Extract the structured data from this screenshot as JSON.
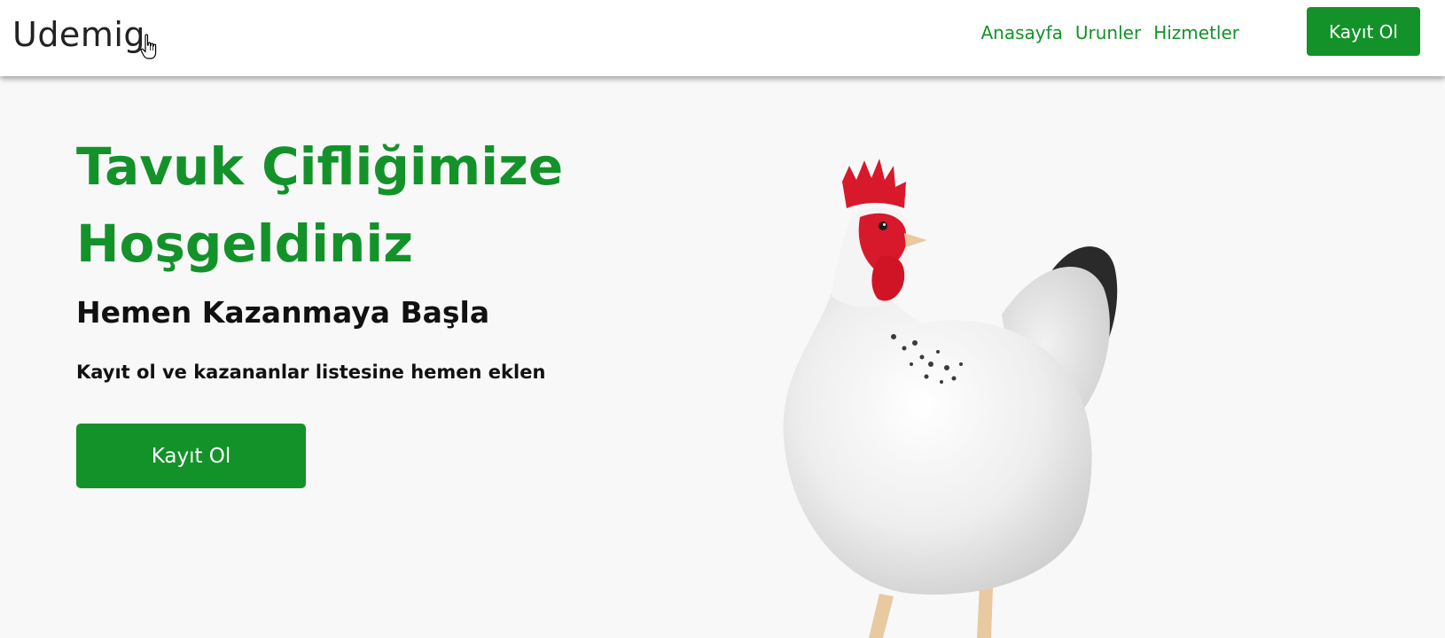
{
  "navbar": {
    "brand": "Udemig",
    "links": [
      "Anasayfa",
      "Urunler",
      "Hizmetler"
    ],
    "signup_label": "Kayıt Ol"
  },
  "hero": {
    "title": "Tavuk Çifliğimize Hoşgeldiniz",
    "subtitle": "Hemen Kazanmaya Başla",
    "text": "Kayıt ol ve kazananlar listesine hemen eklen",
    "button_label": "Kayıt Ol"
  },
  "colors": {
    "accent": "#14922a",
    "background": "#f8f8f9",
    "navbar": "#ffffff"
  },
  "icons": {
    "cursor": "hand-pointer-icon",
    "hero_image": "white-chicken"
  }
}
